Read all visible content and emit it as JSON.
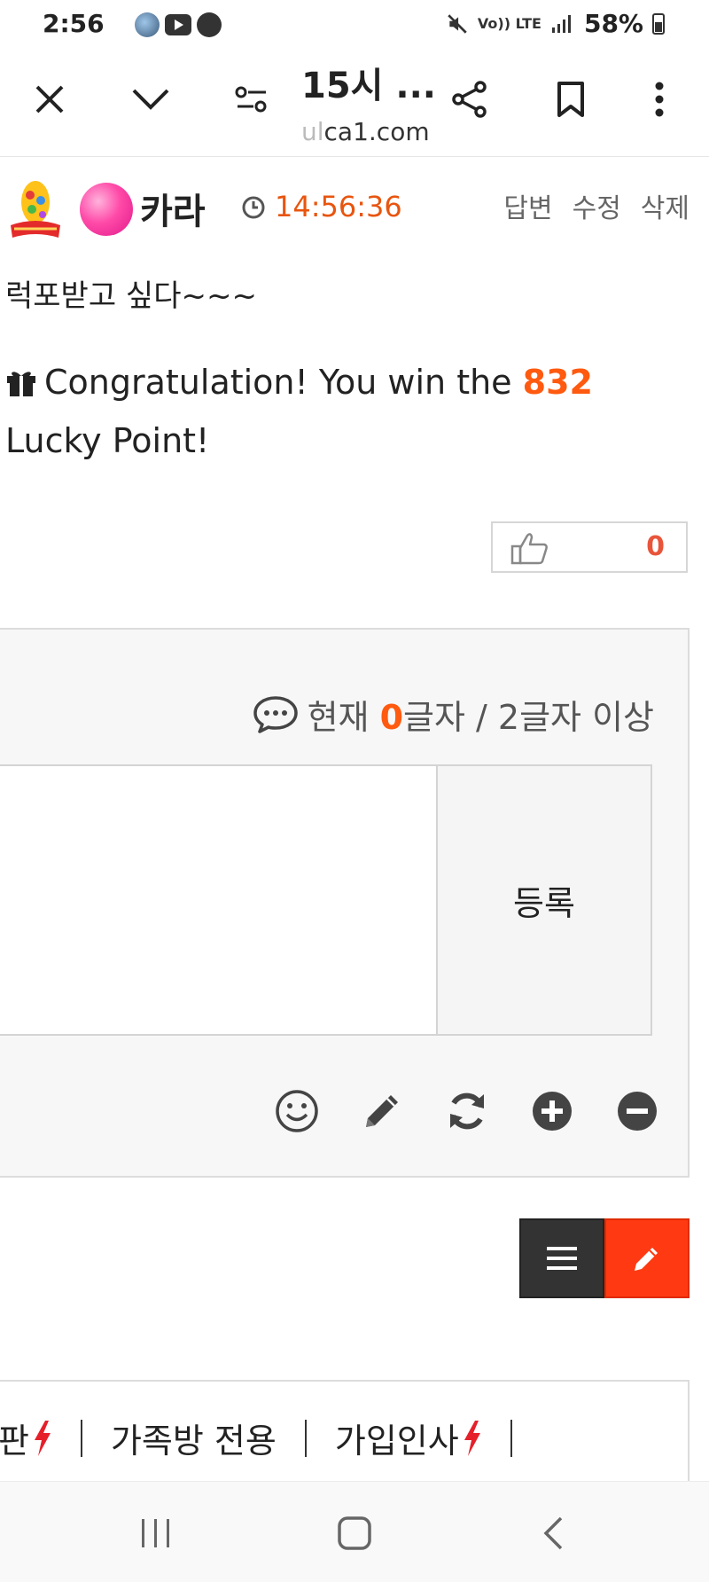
{
  "status_bar": {
    "time": "2:56",
    "network_small": "Vo)) LTE",
    "lte": "LTE",
    "battery": "58%"
  },
  "browser": {
    "title": "15시 ...",
    "url_faded": "ul",
    "url": "ca1.com"
  },
  "comment": {
    "nickname": "카라",
    "time": "14:56:36",
    "actions": [
      "답변",
      "수정",
      "삭제"
    ],
    "body": "럭포받고 싶다~~~",
    "lucky_prefix": "Congratulation! You win the ",
    "lucky_points": "832",
    "lucky_suffix": " Lucky Point!",
    "like_count": "0"
  },
  "write_box": {
    "counter_prefix": "현재 ",
    "counter_value": "0",
    "counter_suffix": "글자 / 2글자 이상",
    "submit_label": "등록",
    "tools": [
      "smile-icon",
      "pencil-icon",
      "refresh-icon",
      "plus-circle-icon",
      "minus-circle-icon"
    ]
  },
  "categories": {
    "items": [
      "판",
      "가족방 전용",
      "가입인사"
    ]
  },
  "colors": {
    "accent_orange": "#ff5a0f",
    "time_orange": "#e8550f",
    "write_button_red": "#ff3a12",
    "bolt_red": "#e5202a"
  }
}
